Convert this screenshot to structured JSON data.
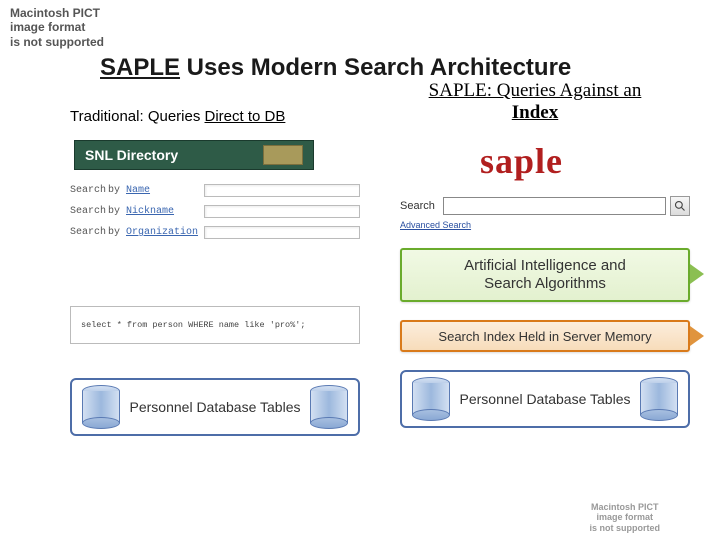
{
  "errors": {
    "pict_top": "Macintosh PICT\nimage format\nis not supported",
    "pict_bottom": "Macintosh PICT\nimage format\nis not supported"
  },
  "title": {
    "emph": "SAPLE",
    "rest": " Uses Modern Search Architecture"
  },
  "left": {
    "heading_prefix": "Traditional: Queries ",
    "heading_emph": "Direct to DB",
    "snl_label": "SNL Directory",
    "form": {
      "search_word": "Search",
      "by_word": "by",
      "rows": [
        {
          "label": "Name"
        },
        {
          "label": "Nickname"
        },
        {
          "label": "Organization"
        }
      ]
    },
    "sql": "select * from person WHERE name like 'pro%';",
    "db_label": "Personnel Database Tables"
  },
  "right": {
    "heading_line1": "SAPLE: Queries Against an",
    "heading_line2": "Index",
    "logo": "saple",
    "search_label": "Search",
    "advanced": "Advanced Search",
    "stage_green": "Artificial Intelligence and\nSearch Algorithms",
    "stage_orange": "Search Index Held in Server Memory",
    "db_label": "Personnel Database Tables"
  }
}
